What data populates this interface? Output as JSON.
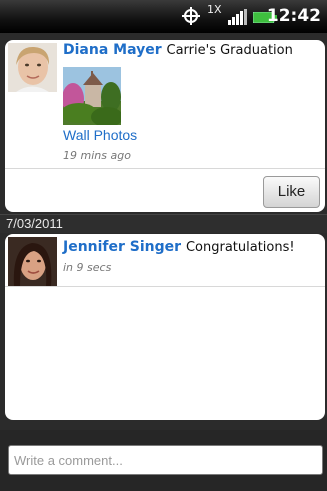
{
  "status_bar": {
    "network_label": "1X",
    "time": "12:42",
    "icons": [
      "gps-icon",
      "data-network-icon",
      "signal-strength-icon",
      "battery-icon"
    ]
  },
  "post": {
    "author": "Diana Mayer",
    "text": "Carrie's Graduation",
    "album": "Wall Photos",
    "time": "19 mins ago",
    "like_label": "Like"
  },
  "date_header": "7/03/2011",
  "comments": [
    {
      "author": "Jennifer Singer",
      "text": "Congratulations!",
      "time": "in 9 secs"
    }
  ],
  "composer": {
    "placeholder": "Write a comment..."
  },
  "colors": {
    "link_blue": "#1f6ec8",
    "background": "#2b2b2b"
  }
}
